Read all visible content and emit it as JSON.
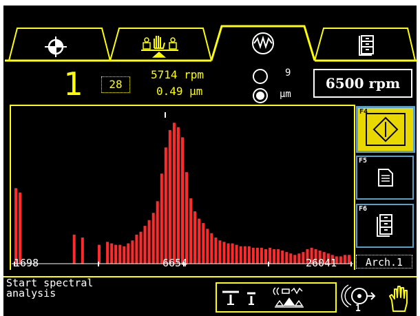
{
  "header": {
    "channel_number": "1",
    "line_count": "28",
    "speed_reading": "5714 rpm",
    "amplitude_reading": "0.49 µm",
    "radio_top_label": "9",
    "radio_bottom_label": "µm",
    "target_speed": "6500 rpm"
  },
  "tabs": [
    {
      "icon": "balance-target-icon",
      "active": false
    },
    {
      "icon": "machine-operators-icon",
      "active": false
    },
    {
      "icon": "vibration-waveform-icon",
      "active": true
    },
    {
      "icon": "archive-cabinet-icon",
      "active": false
    }
  ],
  "axis": {
    "x_tick_labels": [
      "1698",
      "6654",
      "26041"
    ]
  },
  "function_keys": [
    {
      "key": "F4",
      "icon": "start-diamond-icon",
      "selected": true
    },
    {
      "key": "F5",
      "icon": "document-icon",
      "selected": false
    },
    {
      "key": "F6",
      "icon": "archive-cabinet-icon",
      "selected": false
    }
  ],
  "archive_label": "Arch.1",
  "status": {
    "message_line1": "Start spectral",
    "message_line2": "analysis",
    "channel_indicator": "1"
  },
  "colors": {
    "accent": "#ffff00",
    "bars": "#ff2a2a",
    "fkey_border": "#5aa0c8"
  },
  "chart_data": {
    "type": "bar",
    "x_tick_labels": [
      "1698",
      "6654",
      "26041"
    ],
    "values": [
      0.52,
      0.49,
      0,
      0,
      0,
      0,
      0,
      0,
      0,
      0,
      0,
      0,
      0,
      0,
      0.2,
      0,
      0.18,
      0,
      0,
      0,
      0.13,
      0,
      0.15,
      0.14,
      0.13,
      0.13,
      0.12,
      0.14,
      0.16,
      0.2,
      0.22,
      0.26,
      0.3,
      0.35,
      0.43,
      0.62,
      0.8,
      0.92,
      0.97,
      0.94,
      0.87,
      0.63,
      0.45,
      0.36,
      0.31,
      0.28,
      0.24,
      0.21,
      0.18,
      0.16,
      0.15,
      0.14,
      0.14,
      0.13,
      0.12,
      0.12,
      0.12,
      0.11,
      0.11,
      0.11,
      0.1,
      0.11,
      0.1,
      0.1,
      0.09,
      0.08,
      0.07,
      0.06,
      0.07,
      0.08,
      0.1,
      0.11,
      0.1,
      0.09,
      0.08,
      0.07,
      0.06,
      0.05,
      0.05,
      0.06,
      0.06
    ],
    "ylim": [
      0,
      1
    ]
  }
}
